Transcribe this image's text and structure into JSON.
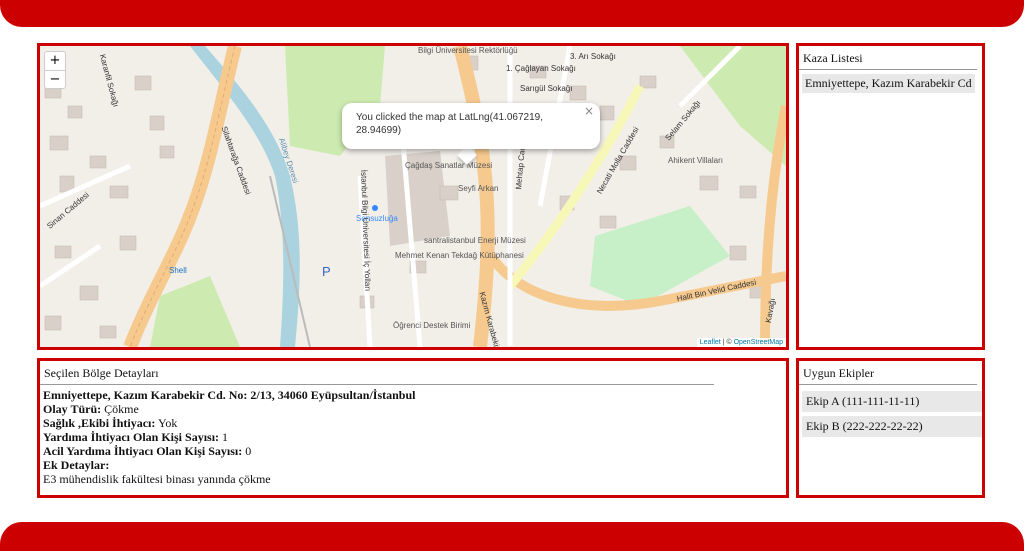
{
  "colors": {
    "accent": "#cc0000",
    "item_bg": "#e8e8e8"
  },
  "map": {
    "zoom_in": "+",
    "zoom_out": "−",
    "popup": {
      "text": "You clicked the map at LatLng(41.067219, 28.94699)",
      "close": "×"
    },
    "attribution": {
      "leaflet": "Leaflet",
      "sep": " | © ",
      "osm": "OpenStreetMap"
    },
    "labels": {
      "bilgi": "Bilgi Üniversitesi Rektörlüğü",
      "cagdas": "Çağdaş Sanatlar Müzesi",
      "santral": "santralistanbul Enerji Müzesi",
      "mehmet": "Mehmet Kenan Tekdağ Kütüphanesi",
      "ogrenci": "Öğrenci Destek Birimi",
      "sonsuzluga": "Sonsuzluğa",
      "shell": "Shell",
      "ahikent": "Ahikent Villaları",
      "seyfi": "Seyfi Arkan",
      "parking": "P"
    },
    "roads": {
      "caglayan": "1. Çağlayan Sokağı",
      "sarigul": "Sarıgül Sokağı",
      "ari": "3. Arı Sokağı",
      "karanfil": "Karanfil Sokağı",
      "silahtaraga": "Silahtarağa Caddesi",
      "sinan": "Sinan Caddesi",
      "alibey": "Alibey Deresi",
      "necati": "Necati Molla Caddesi",
      "selam": "Selam Sokağı",
      "mehtap": "Mehtap Caddesi",
      "halit": "Halit Bin Velid Caddesi",
      "kazim": "Kazım Karabekir",
      "bilgi_yolu": "İstanbul Bilgi Üniversitesi İç Yolları",
      "kavagi": "Kavağı"
    }
  },
  "incident_list": {
    "title": "Kaza Listesi",
    "items": [
      "Emniyettepe, Kazım Karabekir Cd"
    ]
  },
  "details": {
    "title": "Seçilen Bölge Detayları",
    "address": "Emniyettepe, Kazım Karabekir Cd. No: 2/13, 34060 Eyüpsultan/İstanbul",
    "event_type_label": "Olay Türü:",
    "event_type": "Çökme",
    "health_label": "Sağlık ,Ekibi İhtiyacı:",
    "health": "Yok",
    "help_label": "Yardıma İhtiyacı Olan Kişi Sayısı:",
    "help": "1",
    "urgent_label": "Acil Yardıma İhtiyacı Olan Kişi Sayısı:",
    "urgent": "0",
    "extra_label": "Ek Detaylar:",
    "extra": "E3 mühendislik fakültesi binası yanında çökme"
  },
  "teams": {
    "title": "Uygun Ekipler",
    "items": [
      "Ekip A (111-111-11-11)",
      "Ekip B (222-222-22-22)"
    ]
  }
}
